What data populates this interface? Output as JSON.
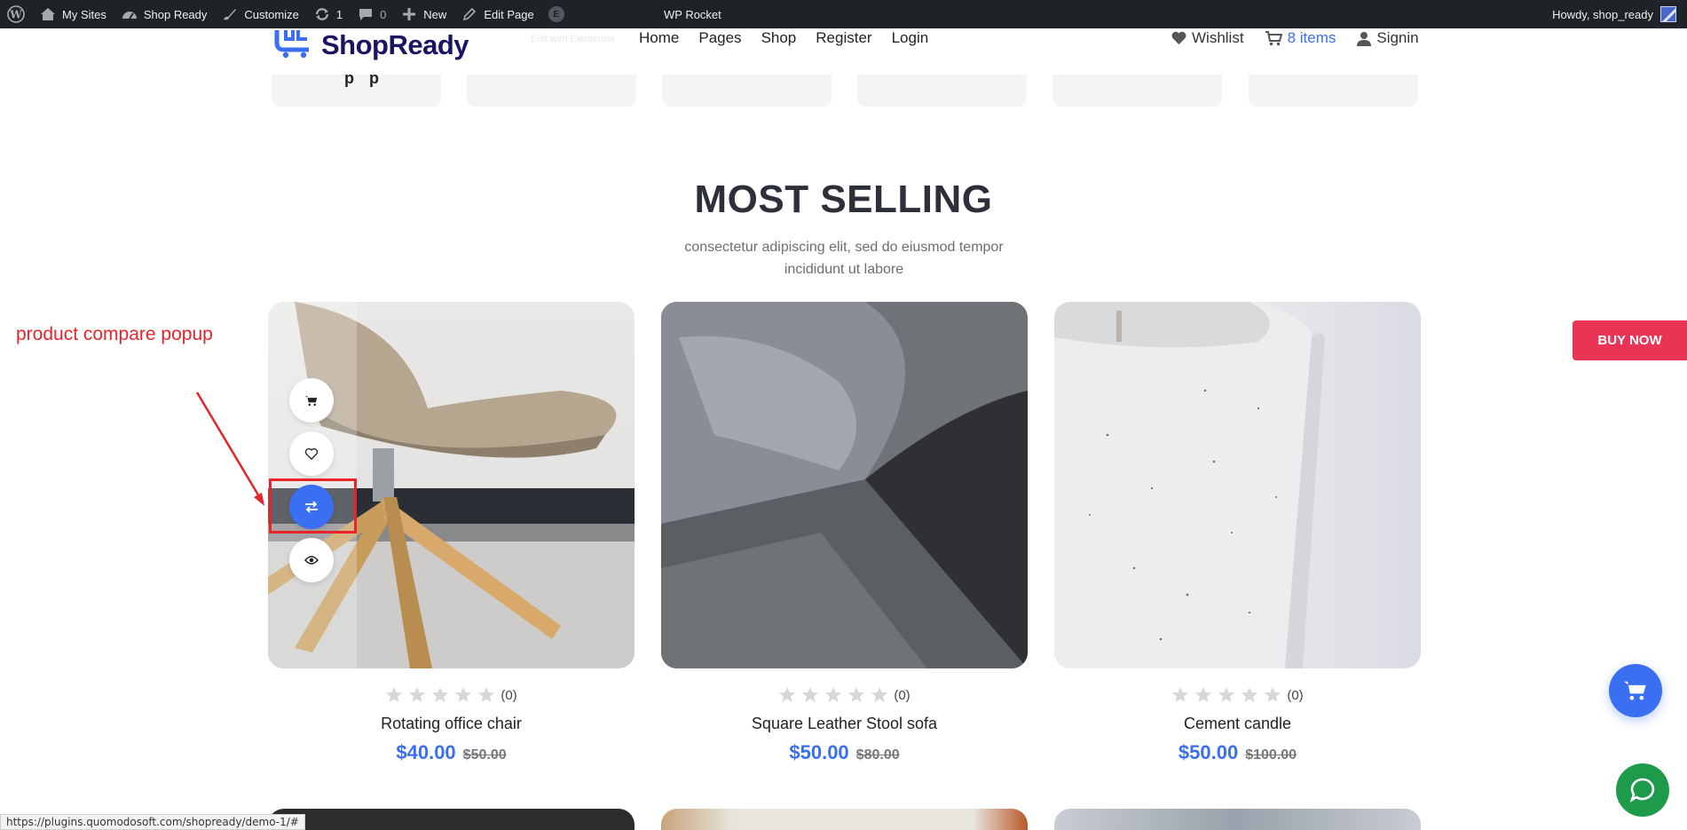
{
  "adminbar": {
    "items": [
      {
        "label": "My Sites",
        "icon": "my-sites-icon"
      },
      {
        "label": "Shop Ready",
        "icon": "dashboard-icon"
      },
      {
        "label": "Customize",
        "icon": "brush-icon"
      },
      {
        "label": "1",
        "icon": "updates-icon"
      },
      {
        "label": "0",
        "icon": "comment-icon"
      },
      {
        "label": "New",
        "icon": "plus-icon"
      },
      {
        "label": "Edit Page",
        "icon": "pencil-icon"
      }
    ],
    "elementor_badge": "E",
    "center_title": "WP Rocket",
    "howdy": "Howdy, shop_ready"
  },
  "header": {
    "logo_text": "ShopReady",
    "edit_with": "Edit with Elementor",
    "nav": [
      "Home",
      "Pages",
      "Shop",
      "Register",
      "Login"
    ],
    "wishlist": "Wishlist",
    "cart": "8 items",
    "signin": "Signin"
  },
  "categories_cut_text": "p p",
  "section": {
    "title": "MOST SELLING",
    "subtitle": "consectetur adipiscing elit, sed do eiusmod tempor incididunt ut labore"
  },
  "annotation": {
    "label": "product compare popup",
    "color": "#e8232a"
  },
  "products": [
    {
      "name": "Rotating office chair",
      "price": "$40.00",
      "old_price": "$50.00",
      "rating_count": "(0)",
      "rating": 0
    },
    {
      "name": "Square Leather Stool sofa",
      "price": "$50.00",
      "old_price": "$80.00",
      "rating_count": "(0)",
      "rating": 0
    },
    {
      "name": "Cement candle",
      "price": "$50.00",
      "old_price": "$100.00",
      "rating_count": "(0)",
      "rating": 0
    }
  ],
  "hover_tools": [
    "cart-icon",
    "heart-icon",
    "compare-icon",
    "eye-icon"
  ],
  "floating": {
    "buy_now": "BUY NOW"
  },
  "status_url": "https://plugins.quomodosoft.com/shopready/demo-1/#",
  "colors": {
    "accent": "#3b6ff2",
    "buy_now": "#ea3456",
    "chat": "#1e9a4b",
    "adminbar": "#1d2327"
  }
}
